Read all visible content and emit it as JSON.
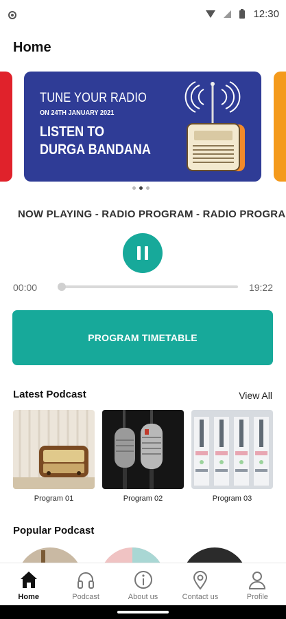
{
  "status_bar": {
    "time": "12:30"
  },
  "header": {
    "title": "Home"
  },
  "banner": {
    "line1": "TUNE YOUR RADIO",
    "line2": "ON 24TH JANUARY 2021",
    "line3": "LISTEN TO",
    "line4": "DURGA BANDANA",
    "background": "#2f3c96"
  },
  "carousel": {
    "pages": 3,
    "active_index": 1
  },
  "player": {
    "now_playing": "NOW PLAYING - RADIO PROGRAM - RADIO PROGRAM",
    "elapsed": "00:00",
    "duration": "19:22",
    "progress": 0.0,
    "state_icon": "pause-icon"
  },
  "timetable_button": {
    "label": "PROGRAM TIMETABLE"
  },
  "latest_podcast": {
    "title": "Latest Podcast",
    "view_all": "View All",
    "items": [
      {
        "label": "Program 01",
        "image": "vintage-radio"
      },
      {
        "label": "Program 02",
        "image": "studio-microphones"
      },
      {
        "label": "Program 03",
        "image": "mixing-console"
      }
    ]
  },
  "popular_podcast": {
    "title": "Popular Podcast"
  },
  "bottom_nav": {
    "items": [
      {
        "label": "Home",
        "icon": "home-icon",
        "active": true
      },
      {
        "label": "Podcast",
        "icon": "headphones-icon",
        "active": false
      },
      {
        "label": "About us",
        "icon": "info-icon",
        "active": false
      },
      {
        "label": "Contact us",
        "icon": "location-pin-icon",
        "active": false
      },
      {
        "label": "Profile",
        "icon": "user-icon",
        "active": false
      }
    ]
  },
  "colors": {
    "accent": "#17a99a",
    "banner_left": "#e0222b",
    "banner_right": "#f49a1c"
  }
}
